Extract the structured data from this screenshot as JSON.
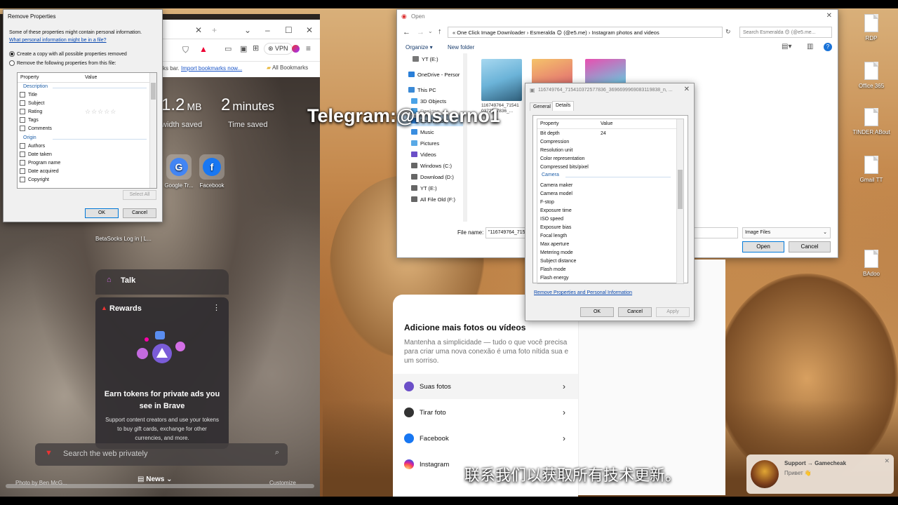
{
  "overlay": {
    "telegram": "Telegram:@msterno1",
    "chinese_caption": "联系我们以获取所有技术更新。"
  },
  "desktop_icons": [
    "RDP",
    "Office 365",
    "TINDER ABout",
    "Gmail TT",
    "BAdoo"
  ],
  "browser": {
    "bookmarks_prefix": "ks bar.",
    "import_bookmarks": "Import bookmarks now...",
    "all_bookmarks": "All Bookmarks",
    "vpn_label": "VPN",
    "bandwidth_value": "1.2",
    "bandwidth_unit": "MB",
    "bandwidth_label": "width saved",
    "time_value": "2",
    "time_unit": "minutes",
    "time_label": "Time saved",
    "tiles": [
      "Google Tr...",
      "Facebook"
    ],
    "small_tiles": "BetaSocks  Log in | L...",
    "talk": "Talk",
    "rewards": {
      "title": "Rewards",
      "heading": "Earn tokens for private ads you see in Brave",
      "body": "Support content creators and use your tokens to buy gift cards, exchange for other currencies, and more."
    },
    "search_placeholder": "Search the web privately",
    "news": "News",
    "photo_credit": "Photo by Ben McG...",
    "customize": "Customize"
  },
  "remove_properties": {
    "title": "Remove Properties",
    "intro": "Some of these properties might contain personal information.",
    "link": "What personal information might be in a file?",
    "option1": "Create a copy with all possible properties removed",
    "option2": "Remove the following properties from this file:",
    "col_property": "Property",
    "col_value": "Value",
    "group_description": "Description",
    "description_items": [
      "Title",
      "Subject",
      "Rating",
      "Tags",
      "Comments"
    ],
    "group_origin": "Origin",
    "origin_items": [
      "Authors",
      "Date taken",
      "Program name",
      "Date acquired",
      "Copyright"
    ],
    "rating_stars": "☆☆☆☆☆",
    "select_all": "Select All",
    "ok": "OK",
    "cancel": "Cancel"
  },
  "open_dialog": {
    "title": "Open",
    "path": "« One Click Image Downloader  ›  Esmeralda 😊 (@e5.me)  ›  Instagram photos and videos",
    "search": "Search Esmeralda 😊 (@e5.me...",
    "organize": "Organize ▾",
    "new_folder": "New folder",
    "nav_items": [
      "YT (E:)",
      "OneDrive - Persor",
      "This PC",
      "3D Objects",
      "Desktop",
      "Downloads",
      "Music",
      "Pictures",
      "Videos",
      "Windows (C:)",
      "Download (D:)",
      "YT (E:)",
      "All File Old (F:)"
    ],
    "thumb_label": "116749764_71541 0372577836_...",
    "file_name_label": "File name:",
    "file_name_value": "\"116749764_715410372577836_3696699969083119838_n.jpg\" \"11682...3_4194994308...",
    "file_type": "Image Files",
    "open": "Open",
    "cancel": "Cancel"
  },
  "props_dialog": {
    "title": "116749764_715410372577836_3696699969083119838_n, ...",
    "tab_general": "General",
    "tab_details": "Details",
    "col_property": "Property",
    "col_value": "Value",
    "bit_depth_label": "Bit depth",
    "bit_depth_value": "24",
    "image_items": [
      "Compression",
      "Resolution unit",
      "Color representation",
      "Compressed bits/pixel"
    ],
    "group_camera": "Camera",
    "camera_items": [
      "Camera maker",
      "Camera model",
      "F-stop",
      "Exposure time",
      "ISO speed",
      "Exposure bias",
      "Focal length",
      "Max aperture",
      "Metering mode",
      "Subject distance",
      "Flash mode",
      "Flash energy"
    ],
    "remove_link": "Remove Properties and Personal Information",
    "ok": "OK",
    "cancel": "Cancel",
    "apply": "Apply"
  },
  "instagram": {
    "heading": "Adicione mais fotos ou vídeos",
    "subtitle": "Mantenha a simplicidade — tudo o que você precisa para criar uma nova conexão é uma foto nítida sua e um sorriso.",
    "options": [
      "Suas fotos",
      "Tirar foto",
      "Facebook",
      "Instagram"
    ]
  },
  "toast": {
    "title": "Support → Gamecheak",
    "body": "Привет 👋"
  }
}
